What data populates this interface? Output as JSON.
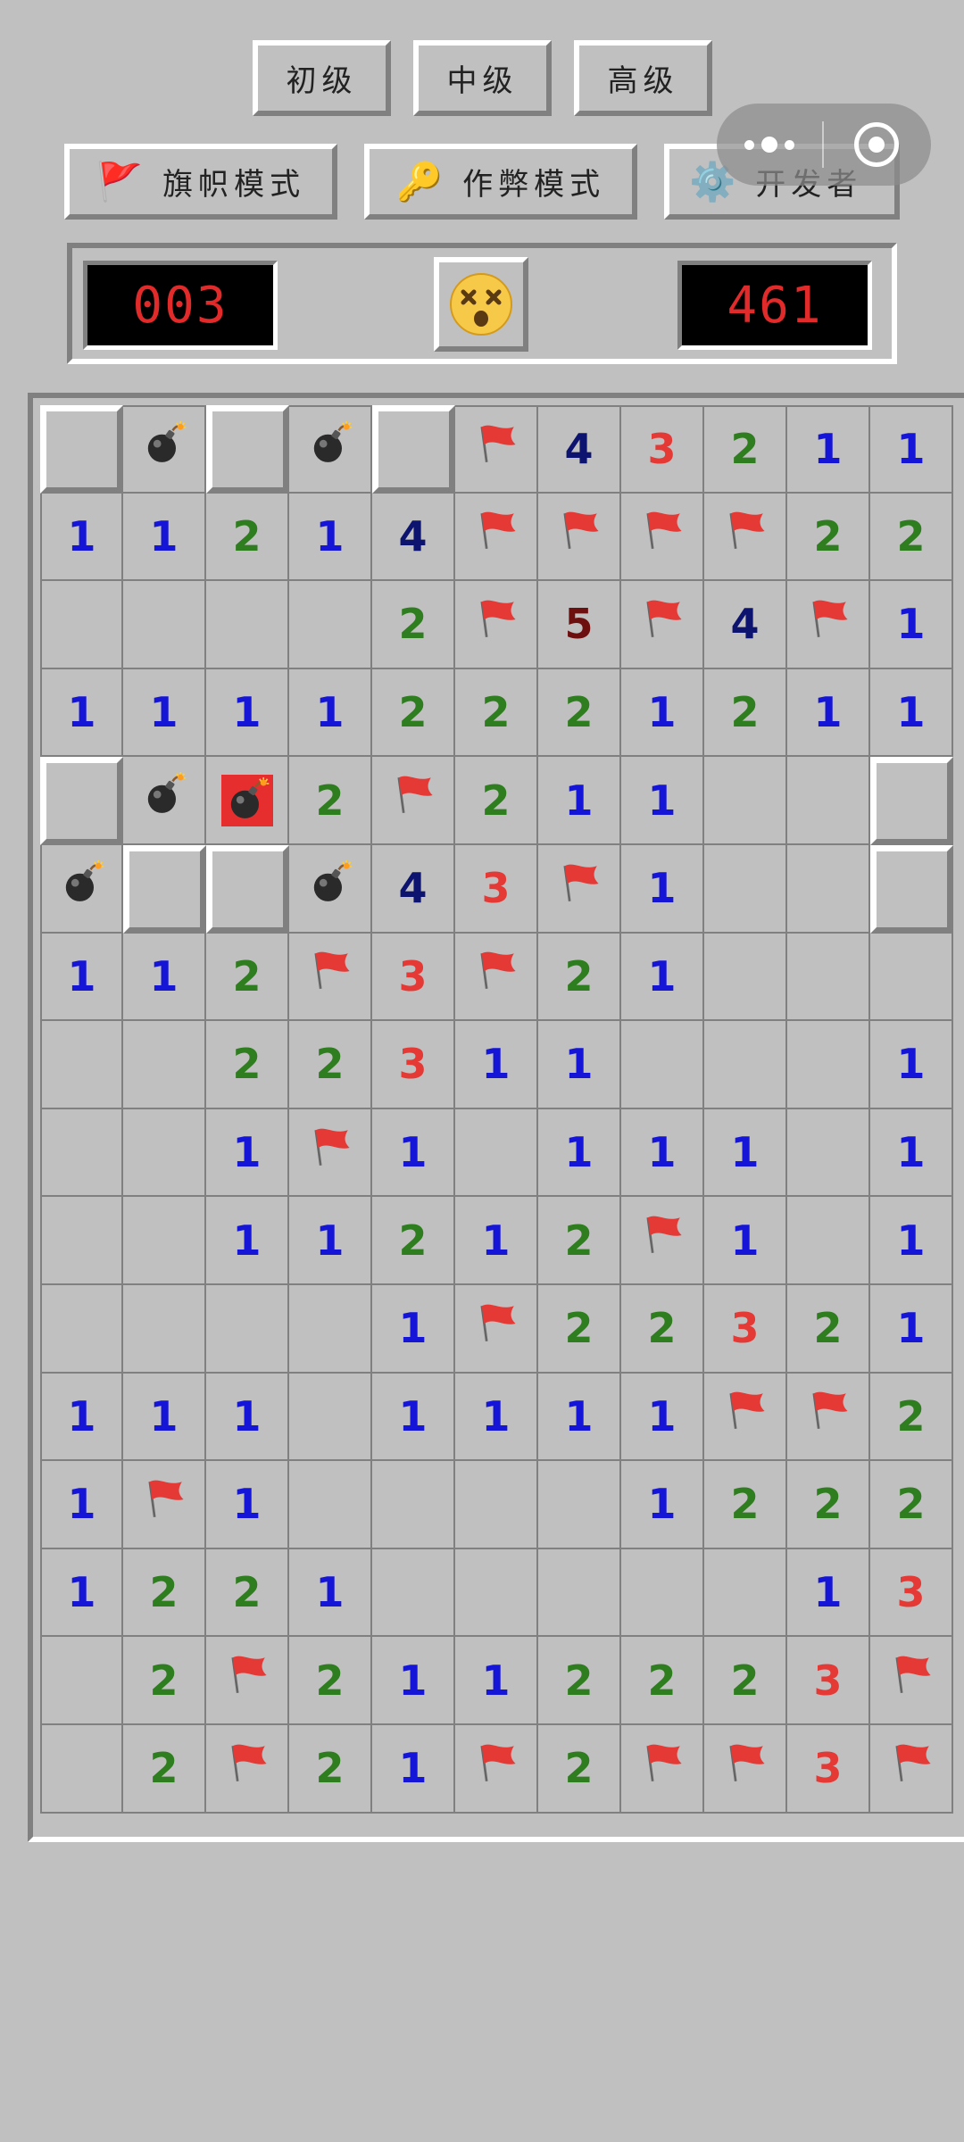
{
  "difficulty": {
    "beginner": "初级",
    "intermediate": "中级",
    "advanced": "高级"
  },
  "modes": {
    "flag_mode": "旗帜模式",
    "cheat_mode": "作弊模式",
    "developer": "开发者"
  },
  "status": {
    "mines_remaining": "003",
    "timer": "461",
    "face_state": "dead"
  },
  "colors": {
    "background": "#c0c0c0",
    "counter_text": "#e12a2a",
    "n1": "#1515d8",
    "n2": "#2e7d1e",
    "n3": "#e53935",
    "n4": "#0d1470",
    "n5": "#6d0f0f",
    "exploded": "#e62e2e"
  },
  "board": {
    "legend": "H=hidden, B=mine, X=exploded mine, F=flag, 0=empty, 1-8=number",
    "rows": [
      [
        "H",
        "B",
        "H",
        "B",
        "H",
        "F",
        "4",
        "3",
        "2",
        "1",
        "1"
      ],
      [
        "1",
        "1",
        "2",
        "1",
        "4",
        "F",
        "F",
        "F",
        "F",
        "2",
        "2"
      ],
      [
        "0",
        "0",
        "0",
        "0",
        "2",
        "F",
        "5",
        "F",
        "4",
        "F",
        "1"
      ],
      [
        "1",
        "1",
        "1",
        "1",
        "2",
        "2",
        "2",
        "1",
        "2",
        "1",
        "1"
      ],
      [
        "H",
        "B",
        "X",
        "2",
        "F",
        "2",
        "1",
        "1",
        "0",
        "0",
        "H"
      ],
      [
        "B",
        "H",
        "H",
        "B",
        "4",
        "3",
        "F",
        "1",
        "0",
        "0",
        "H"
      ],
      [
        "1",
        "1",
        "2",
        "F",
        "3",
        "F",
        "2",
        "1",
        "0",
        "0",
        "0"
      ],
      [
        "0",
        "0",
        "2",
        "2",
        "3",
        "1",
        "1",
        "0",
        "0",
        "0",
        "1"
      ],
      [
        "0",
        "0",
        "1",
        "F",
        "1",
        "0",
        "1",
        "1",
        "1",
        "0",
        "1"
      ],
      [
        "0",
        "0",
        "1",
        "1",
        "2",
        "1",
        "2",
        "F",
        "1",
        "0",
        "1"
      ],
      [
        "0",
        "0",
        "0",
        "0",
        "1",
        "F",
        "2",
        "2",
        "3",
        "2",
        "1"
      ],
      [
        "1",
        "1",
        "1",
        "0",
        "1",
        "1",
        "1",
        "1",
        "F",
        "F",
        "2"
      ],
      [
        "1",
        "F",
        "1",
        "0",
        "0",
        "0",
        "0",
        "1",
        "2",
        "2",
        "2"
      ],
      [
        "1",
        "2",
        "2",
        "1",
        "0",
        "0",
        "0",
        "0",
        "0",
        "1",
        "3"
      ],
      [
        "0",
        "2",
        "F",
        "2",
        "1",
        "1",
        "2",
        "2",
        "2",
        "3",
        "F"
      ],
      [
        "0",
        "2",
        "F",
        "2",
        "1",
        "F",
        "2",
        "F",
        "F",
        "3",
        "F"
      ]
    ]
  }
}
